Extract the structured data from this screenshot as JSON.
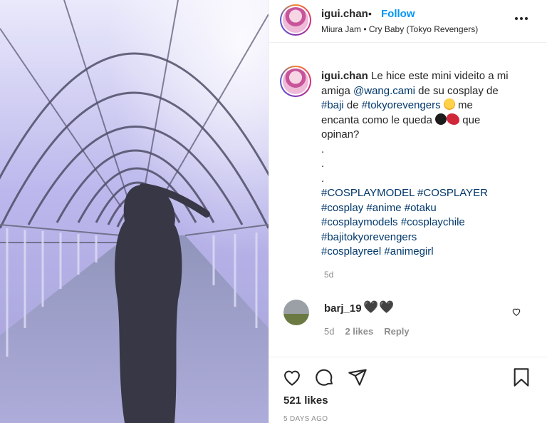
{
  "post": {
    "author": "igui.chan",
    "dot": "•",
    "follow_label": "Follow",
    "audio": "Miura Jam • Cry Baby (Tokyo Revengers)",
    "caption": {
      "author": "igui.chan",
      "text_1": "Le hice este mini videito a mi amiga",
      "mention": "@wang.cami",
      "text_2": "de su cosplay de",
      "tag_baji": "#baji",
      "text_3": "de",
      "tag_tr": "#tokyorevengers",
      "text_4": "me encanta como le queda",
      "text_5": "que opinan?",
      "dots": [
        ".",
        ".",
        "."
      ],
      "hashtags": [
        "#COSPLAYMODEL #COSPLAYER",
        "#cosplay #anime #otaku",
        "#cosplaymodels #cosplaychile",
        "#bajitokyorevengers",
        "#cosplayreel #animegirl"
      ]
    },
    "caption_time": "5d",
    "likes": "521 likes",
    "posted_ago": "5 DAYS AGO"
  },
  "comment": {
    "user": "barj_19",
    "text": "🖤🖤",
    "time": "5d",
    "likes": "2 likes",
    "reply_label": "Reply"
  },
  "icons": {
    "like": "heart-icon",
    "comment": "comment-icon",
    "share": "share-icon",
    "save": "bookmark-icon",
    "more": "more-options-icon"
  },
  "colors": {
    "accent": "#0095f6",
    "link": "#00376b",
    "muted": "#8e8e8e"
  }
}
